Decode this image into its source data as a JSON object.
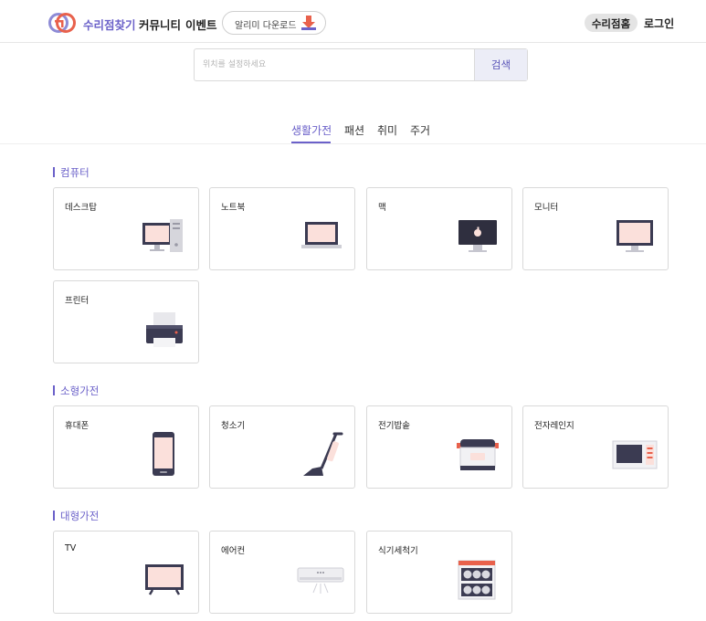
{
  "header": {
    "brand": "수리점찾기",
    "nav": [
      "커뮤니티",
      "이벤트"
    ],
    "download_label": "알리미 다운로드",
    "home_label": "수리점홈",
    "login_label": "로그인"
  },
  "search": {
    "placeholder": "위치를 설정하세요",
    "button_label": "검색"
  },
  "tabs": [
    "생활가전",
    "패션",
    "취미",
    "주거"
  ],
  "colors": {
    "accent": "#6b61c9",
    "screen": "#fbe0db",
    "device": "#3b3b52"
  },
  "sections": [
    {
      "title": "컴퓨터",
      "items": [
        "데스크탑",
        "노트북",
        "맥",
        "모니터",
        "프린터"
      ]
    },
    {
      "title": "소형가전",
      "items": [
        "휴대폰",
        "청소기",
        "전기밥솥",
        "전자레인지"
      ]
    },
    {
      "title": "대형가전",
      "items": [
        "TV",
        "에어컨",
        "식기세척기"
      ]
    }
  ]
}
